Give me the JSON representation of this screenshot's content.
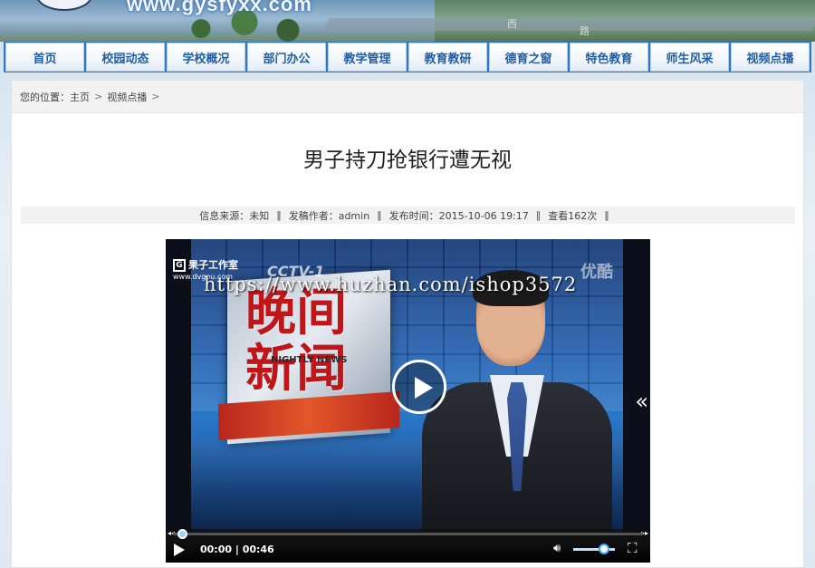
{
  "banner": {
    "site_url": "www.gysfyxx.com",
    "road_text_1": "西",
    "road_text_2": "路"
  },
  "nav": {
    "items": [
      {
        "label": "首页"
      },
      {
        "label": "校园动态"
      },
      {
        "label": "学校概况"
      },
      {
        "label": "部门办公"
      },
      {
        "label": "教学管理"
      },
      {
        "label": "教育教研"
      },
      {
        "label": "德育之窗"
      },
      {
        "label": "特色教育"
      },
      {
        "label": "师生风采"
      },
      {
        "label": "视频点播"
      }
    ],
    "colors": {
      "bar": "#2d78c8",
      "text": "#1f5fa8"
    }
  },
  "breadcrumb": {
    "prefix": "您的位置：",
    "home": "主页",
    "section": "视频点播",
    "sep": ">"
  },
  "article": {
    "title": "男子持刀抢银行遭无视",
    "meta": {
      "source": "信息来源：未知",
      "author": "发稿作者：admin",
      "published": "发布时间：2015-10-06 19:17",
      "views": "查看162次",
      "divider": "‖"
    }
  },
  "video": {
    "studio_logo": "果子工作室",
    "studio_url": "www.dvgou.com",
    "channel": "CCTV-1",
    "program_title": "晚间新闻",
    "program_subtitle": "NIGHTLY NEWS",
    "youku": "优酷",
    "watermark": "https://www.huzhan.com/ishop3572",
    "time_display": "00:00 | 00:46",
    "current_time": "00:00",
    "duration": "00:46",
    "progress_fraction": 0.0,
    "volume_fraction": 0.7,
    "icons": {
      "play": "play-icon",
      "volume": "volume-icon",
      "fullscreen": "fullscreen-icon",
      "side_panel": "double-chevron-left-icon"
    }
  }
}
